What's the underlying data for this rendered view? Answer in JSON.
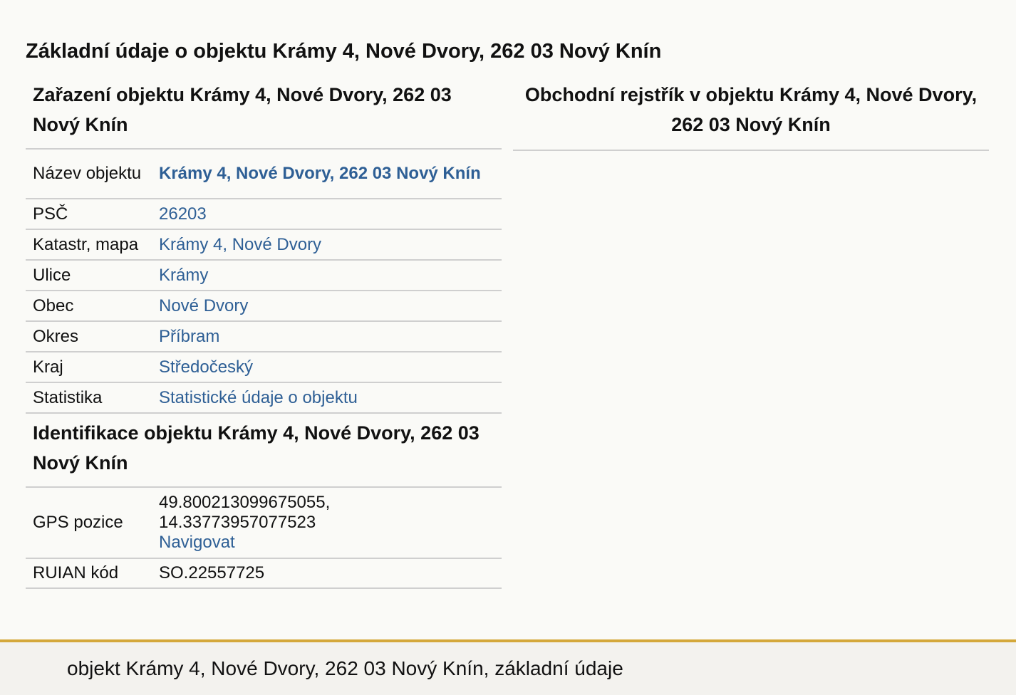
{
  "page": {
    "title": "Základní údaje o objektu Krámy 4, Nové Dvory, 262 03 Nový Knín"
  },
  "zarazeni": {
    "heading": "Zařazení objektu Krámy 4, Nové Dvory, 262 03 Nový Knín",
    "rows": [
      {
        "label": "Název objektu",
        "value": "Krámy 4, Nové Dvory, 262 03 Nový Knín"
      },
      {
        "label": "PSČ",
        "value": "26203"
      },
      {
        "label": "Katastr, mapa",
        "value": "Krámy 4, Nové Dvory"
      },
      {
        "label": "Ulice",
        "value": "Krámy"
      },
      {
        "label": "Obec",
        "value": "Nové Dvory"
      },
      {
        "label": "Okres",
        "value": "Příbram"
      },
      {
        "label": "Kraj",
        "value": "Středočeský"
      },
      {
        "label": "Statistika",
        "value": "Statistické údaje o objektu"
      }
    ]
  },
  "identifikace": {
    "heading": "Identifikace objektu Krámy 4, Nové Dvory, 262 03 Nový Knín",
    "gps": {
      "label": "GPS pozice",
      "lat": "49.800213099675055,",
      "lon": "14.33773957077523",
      "navigate": "Navigovat"
    },
    "ruian": {
      "label": "RUIAN kód",
      "value": "SO.22557725"
    }
  },
  "obchodni_rejstrik": {
    "heading": "Obchodní rejstřík v objektu Krámy 4, Nové Dvory, 262 03 Nový Knín"
  },
  "footer": {
    "text": "objekt Krámy 4, Nové Dvory, 262 03 Nový Knín, základní údaje"
  },
  "colors": {
    "link": "#2e5f95",
    "footer_border": "#d4a83a",
    "divider": "#cfcfcf",
    "background": "#fafaf7"
  }
}
